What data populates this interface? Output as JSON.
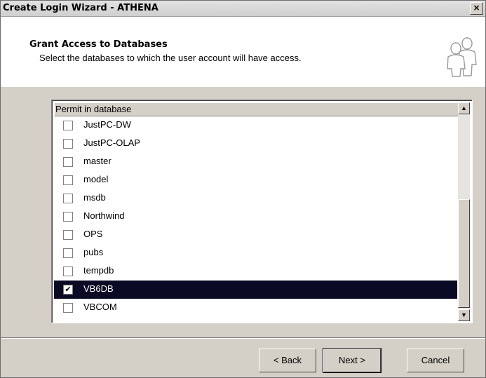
{
  "window": {
    "title": "Create Login Wizard - ATHENA",
    "close_label": "×"
  },
  "header": {
    "title": "Grant Access to Databases",
    "subtitle": "Select the databases to which the user account will have access."
  },
  "list": {
    "column_header": "Permit in database",
    "items": [
      {
        "label": "JustPC-DW",
        "checked": false,
        "selected": false
      },
      {
        "label": "JustPC-OLAP",
        "checked": false,
        "selected": false
      },
      {
        "label": "master",
        "checked": false,
        "selected": false
      },
      {
        "label": "model",
        "checked": false,
        "selected": false
      },
      {
        "label": "msdb",
        "checked": false,
        "selected": false
      },
      {
        "label": "Northwind",
        "checked": false,
        "selected": false
      },
      {
        "label": "OPS",
        "checked": false,
        "selected": false
      },
      {
        "label": "pubs",
        "checked": false,
        "selected": false
      },
      {
        "label": "tempdb",
        "checked": false,
        "selected": false
      },
      {
        "label": "VB6DB",
        "checked": true,
        "selected": true
      },
      {
        "label": "VBCOM",
        "checked": false,
        "selected": false
      }
    ]
  },
  "buttons": {
    "back": "< Back",
    "next": "Next >",
    "cancel": "Cancel"
  }
}
